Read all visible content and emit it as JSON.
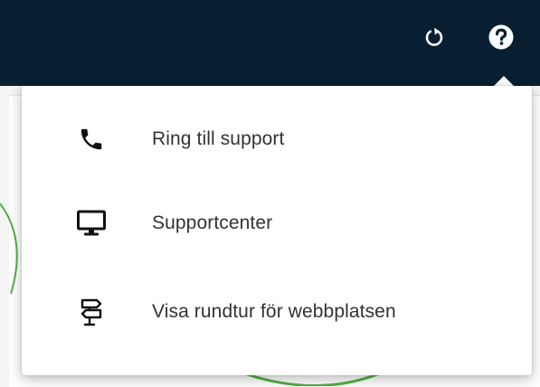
{
  "topbar": {
    "background": "#071f30",
    "icons": [
      "refresh-icon",
      "help-icon"
    ]
  },
  "help_menu": {
    "items": [
      {
        "label": "Ring till support",
        "icon": "phone-icon"
      },
      {
        "label": "Supportcenter",
        "icon": "monitor-icon"
      },
      {
        "label": "Visa rundtur för webbplatsen",
        "icon": "signpost-icon"
      }
    ]
  },
  "colors": {
    "topbar": "#071f30",
    "menu_background": "#ffffff",
    "text": "#333333",
    "decoration_green": "#52b043"
  }
}
